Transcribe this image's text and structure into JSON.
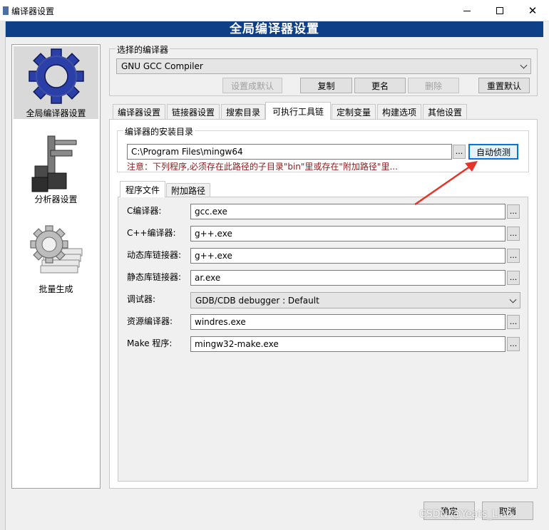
{
  "window": {
    "title": "编译器设置",
    "banner": "全局编译器设置"
  },
  "nav": {
    "items": [
      {
        "label": "全局编译器设置",
        "icon": "gear-icon",
        "selected": true
      },
      {
        "label": "分析器设置",
        "icon": "caliper-icon",
        "selected": false
      },
      {
        "label": "批量生成",
        "icon": "batch-gear-icon",
        "selected": false
      }
    ]
  },
  "compiler_select": {
    "group_title": "选择的编译器",
    "selected": "GNU GCC Compiler",
    "buttons": {
      "set_default": "设置成默认",
      "copy": "复制",
      "rename": "更名",
      "delete": "删除",
      "reset_defaults": "重置默认"
    }
  },
  "tabs": [
    "编译器设置",
    "链接器设置",
    "搜索目录",
    "可执行工具链",
    "定制变量",
    "构建选项",
    "其他设置"
  ],
  "active_tab": "可执行工具链",
  "install_dir": {
    "group_title": "编译器的安装目录",
    "path": "C:\\Program Files\\mingw64",
    "browse": "...",
    "auto_detect": "自动侦测",
    "note": "注意：下列程序,必须存在此路径的子目录\"bin\"里或存在\"附加路径\"里..."
  },
  "subtabs": [
    "程序文件",
    "附加路径"
  ],
  "programs": [
    {
      "label": "C编译器:",
      "value": "gcc.exe",
      "type": "text"
    },
    {
      "label": "C++编译器:",
      "value": "g++.exe",
      "type": "text"
    },
    {
      "label": "动态库链接器:",
      "value": "g++.exe",
      "type": "text"
    },
    {
      "label": "静态库链接器:",
      "value": "ar.exe",
      "type": "text"
    },
    {
      "label": "调试器:",
      "value": "GDB/CDB debugger : Default",
      "type": "select"
    },
    {
      "label": "资源编译器:",
      "value": "windres.exe",
      "type": "text"
    },
    {
      "label": "Make 程序:",
      "value": "mingw32-make.exe",
      "type": "text"
    }
  ],
  "footer": {
    "ok": "确定",
    "cancel": "取消",
    "watermark": "CSDN @Yeats_Liao"
  },
  "colors": {
    "banner_bg": "#0f3f87",
    "annotation_arrow": "#e8332a",
    "note_text": "#8b1a1a",
    "focus_border": "#0078d7"
  }
}
